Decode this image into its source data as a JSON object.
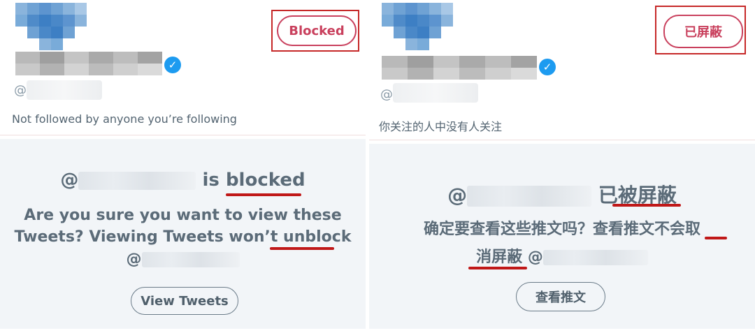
{
  "colors": {
    "blocked_accent": "#c9405d",
    "verified_blue": "#1d9bf0",
    "annotation_red": "#c62828",
    "panel_grey": "#f2f5f8"
  },
  "left": {
    "handle_prefix": "@",
    "followers_note": "Not followed by anyone you’re following",
    "blocked_button": "Blocked",
    "headline_at": "@",
    "headline_is": "is",
    "headline_blocked": "blocked",
    "warning_line1": "Are you sure you want to view these",
    "warning_line2_a": "Tweets? Viewing Tweets won’t",
    "warning_line2_b": "unblock",
    "warning_line3_at": "@",
    "view_button": "View Tweets",
    "verified_icon": "verified-check-icon"
  },
  "right": {
    "handle_prefix": "@",
    "followers_note": "你关注的人中没有人关注",
    "blocked_button": "已屏蔽",
    "headline_at": "@",
    "headline_yi": "已",
    "headline_blocked": "被屏蔽",
    "warning_line1_a": "确定要查看这些推文吗？查看推文不会",
    "warning_line1_b": "取",
    "warning_line2_a": "消屏蔽",
    "warning_line2_b": "@",
    "view_button": "查看推文",
    "verified_icon": "verified-check-icon"
  }
}
